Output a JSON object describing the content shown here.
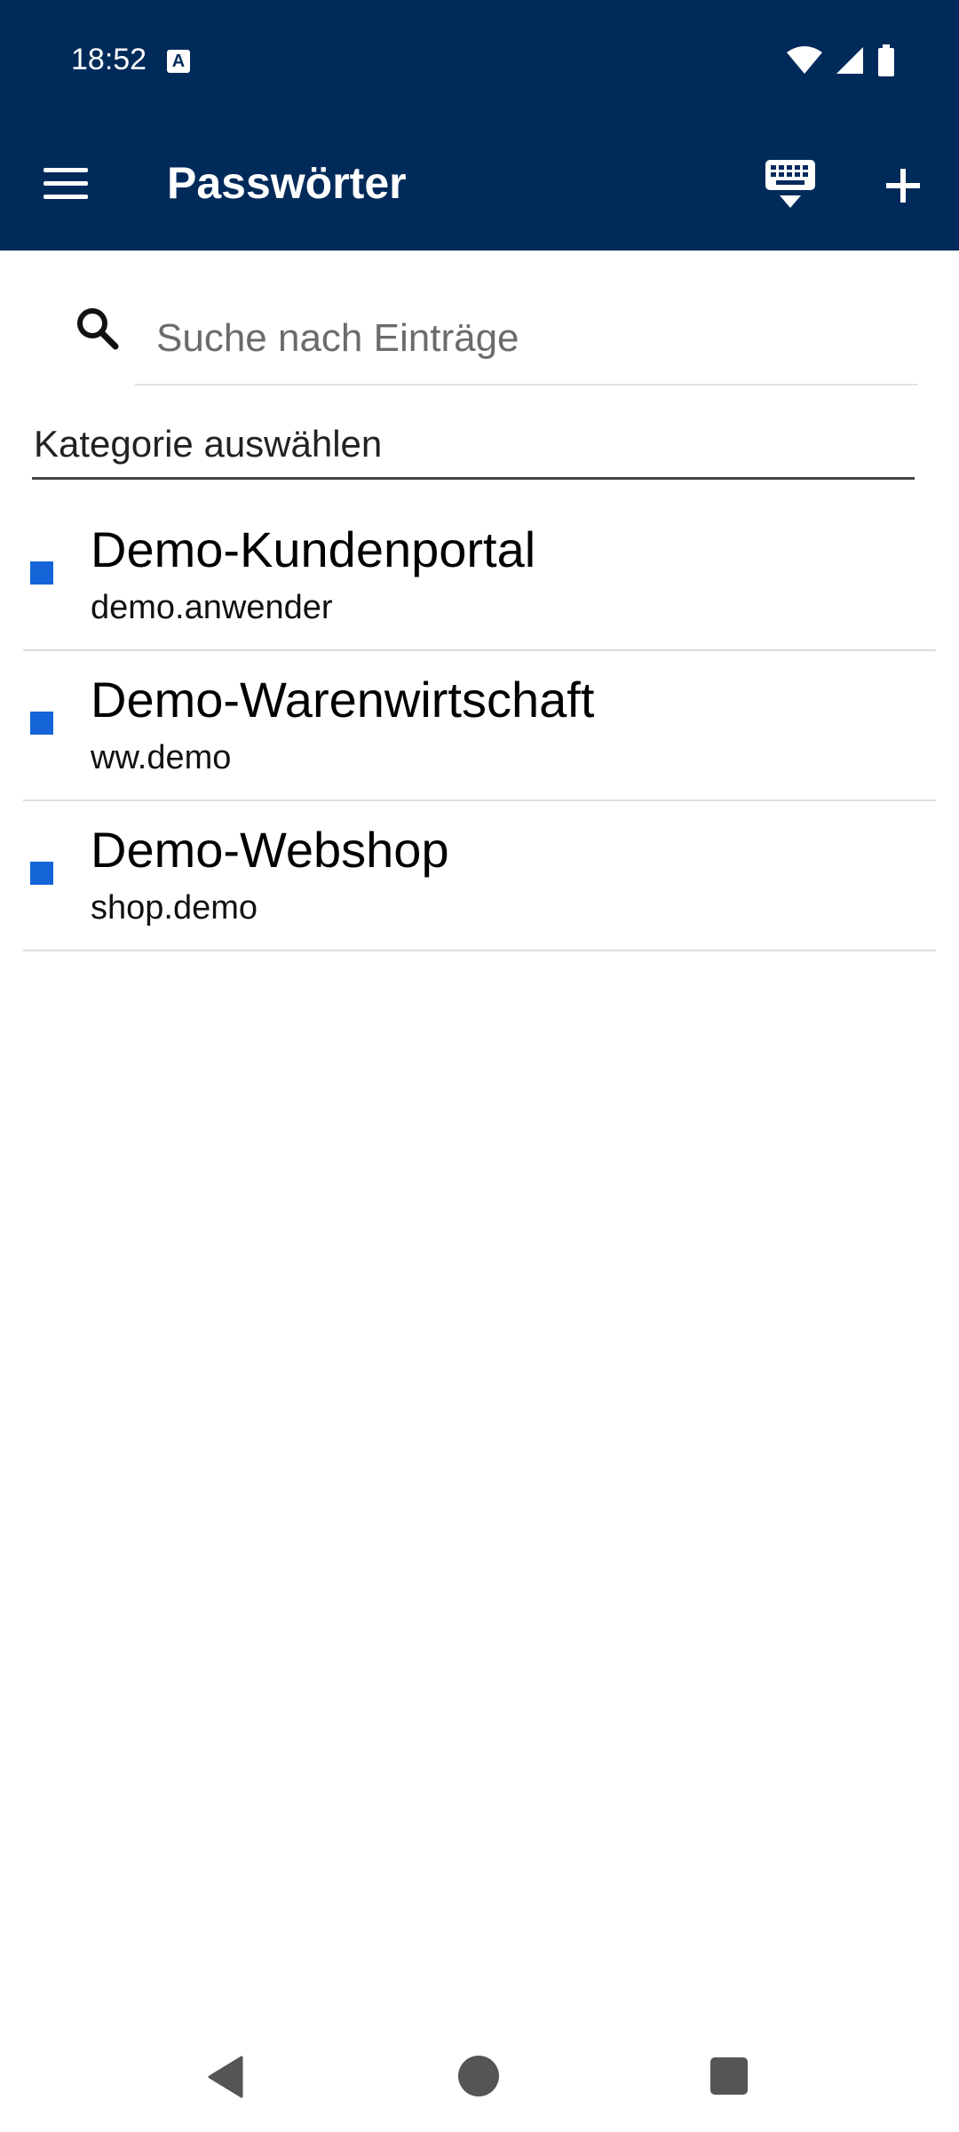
{
  "status_bar": {
    "time": "18:52",
    "indicator_glyph": "A",
    "icons": [
      "wifi-icon",
      "signal-icon",
      "battery-icon"
    ]
  },
  "app_bar": {
    "title": "Passwörter",
    "menu_icon": "hamburger-menu-icon",
    "keyboard_icon": "keyboard-hide-icon",
    "add_icon": "plus-icon"
  },
  "search": {
    "placeholder": "Suche nach Einträge",
    "value": ""
  },
  "category": {
    "label": "Kategorie auswählen"
  },
  "entries": [
    {
      "title": "Demo-Kundenportal",
      "username": "demo.anwender"
    },
    {
      "title": "Demo-Warenwirtschaft",
      "username": "ww.demo"
    },
    {
      "title": "Demo-Webshop",
      "username": "shop.demo"
    }
  ],
  "colors": {
    "primary": "#002a5a",
    "entry_marker": "#1565d8"
  },
  "nav_bar": {
    "icons": [
      "back-icon",
      "home-icon",
      "recents-icon"
    ]
  }
}
